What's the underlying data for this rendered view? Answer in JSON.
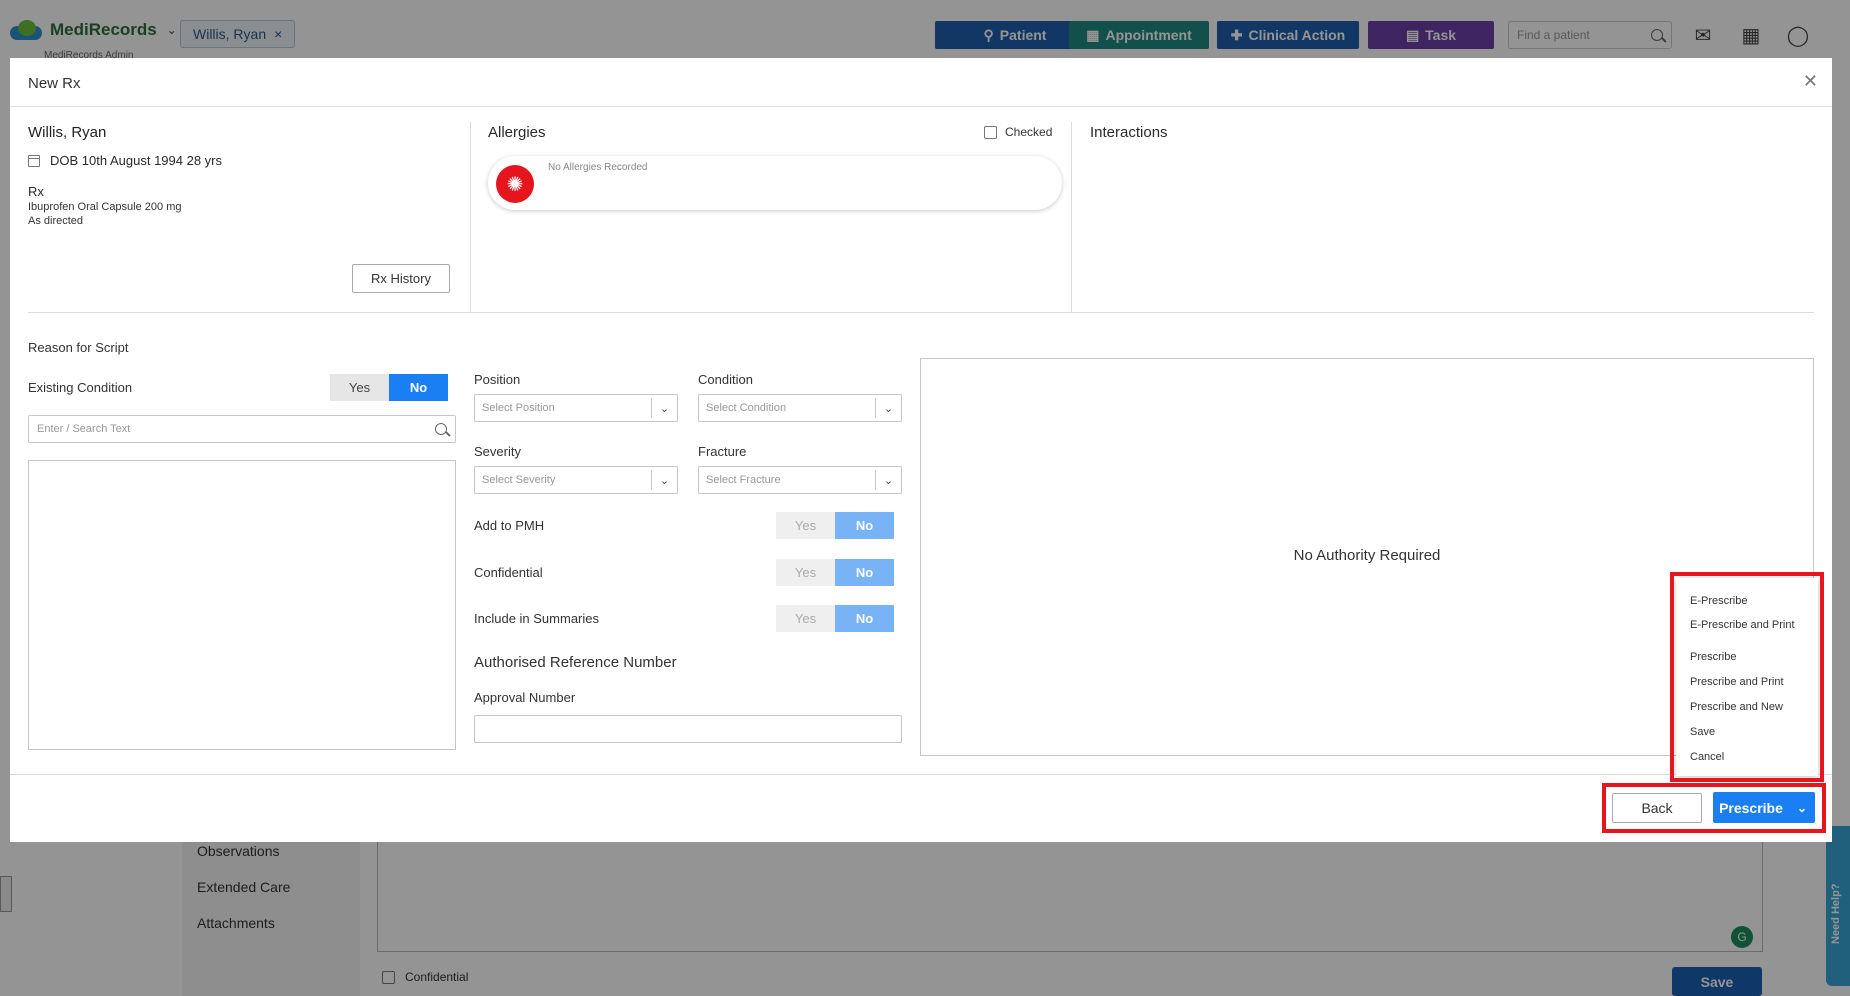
{
  "colors": {
    "accent": "#1a7ff2",
    "highlight": "#e8161c",
    "allergy": "#e5141d"
  },
  "app": {
    "logo_text": "MediRecords",
    "logo_sub": "MediRecords Admin",
    "patient_tab": "Willis, Ryan",
    "nav_buttons": [
      {
        "label": "Patient",
        "color": "#1f5fae",
        "icon": "person-add-icon"
      },
      {
        "label": "Appointment",
        "color": "#1f8b82",
        "icon": "calendar-add-icon"
      },
      {
        "label": "Clinical Action",
        "color": "#1f5fae",
        "icon": "medical-bag-icon"
      },
      {
        "label": "Task",
        "color": "#6b3fa8",
        "icon": "clipboard-icon"
      }
    ],
    "find_placeholder": "Find a patient"
  },
  "background": {
    "nav_items": [
      "Observations",
      "Extended Care",
      "Attachments"
    ],
    "confidential_label": "Confidential",
    "save_label": "Save",
    "need_help": "Need Help?"
  },
  "modal": {
    "title": "New Rx",
    "patient_name": "Willis, Ryan",
    "dob": "DOB 10th August 1994 28 yrs",
    "rx_label": "Rx",
    "rx_drug": "Ibuprofen Oral Capsule 200 mg",
    "rx_directions": "As directed",
    "rx_history": "Rx History",
    "allergies_title": "Allergies",
    "checked_label": "Checked",
    "no_allergies": "No Allergies Recorded",
    "interactions_title": "Interactions",
    "reason_label": "Reason for Script",
    "existing_condition": "Existing Condition",
    "yes": "Yes",
    "no": "No",
    "search_placeholder": "Enter / Search Text",
    "position_label": "Position",
    "position_placeholder": "Select Position",
    "condition_label": "Condition",
    "condition_placeholder": "Select Condition",
    "severity_label": "Severity",
    "severity_placeholder": "Select Severity",
    "fracture_label": "Fracture",
    "fracture_placeholder": "Select Fracture",
    "add_to_pmh": "Add to PMH",
    "confidential": "Confidential",
    "include_summaries": "Include in Summaries",
    "auth_ref_title": "Authorised Reference Number",
    "approval_label": "Approval Number",
    "authority_text": "No Authority Required",
    "back": "Back",
    "prescribe": "Prescribe",
    "dropdown": [
      "E-Prescribe",
      "E-Prescribe and Print",
      "Prescribe",
      "Prescribe and Print",
      "Prescribe and New",
      "Save",
      "Cancel"
    ]
  }
}
